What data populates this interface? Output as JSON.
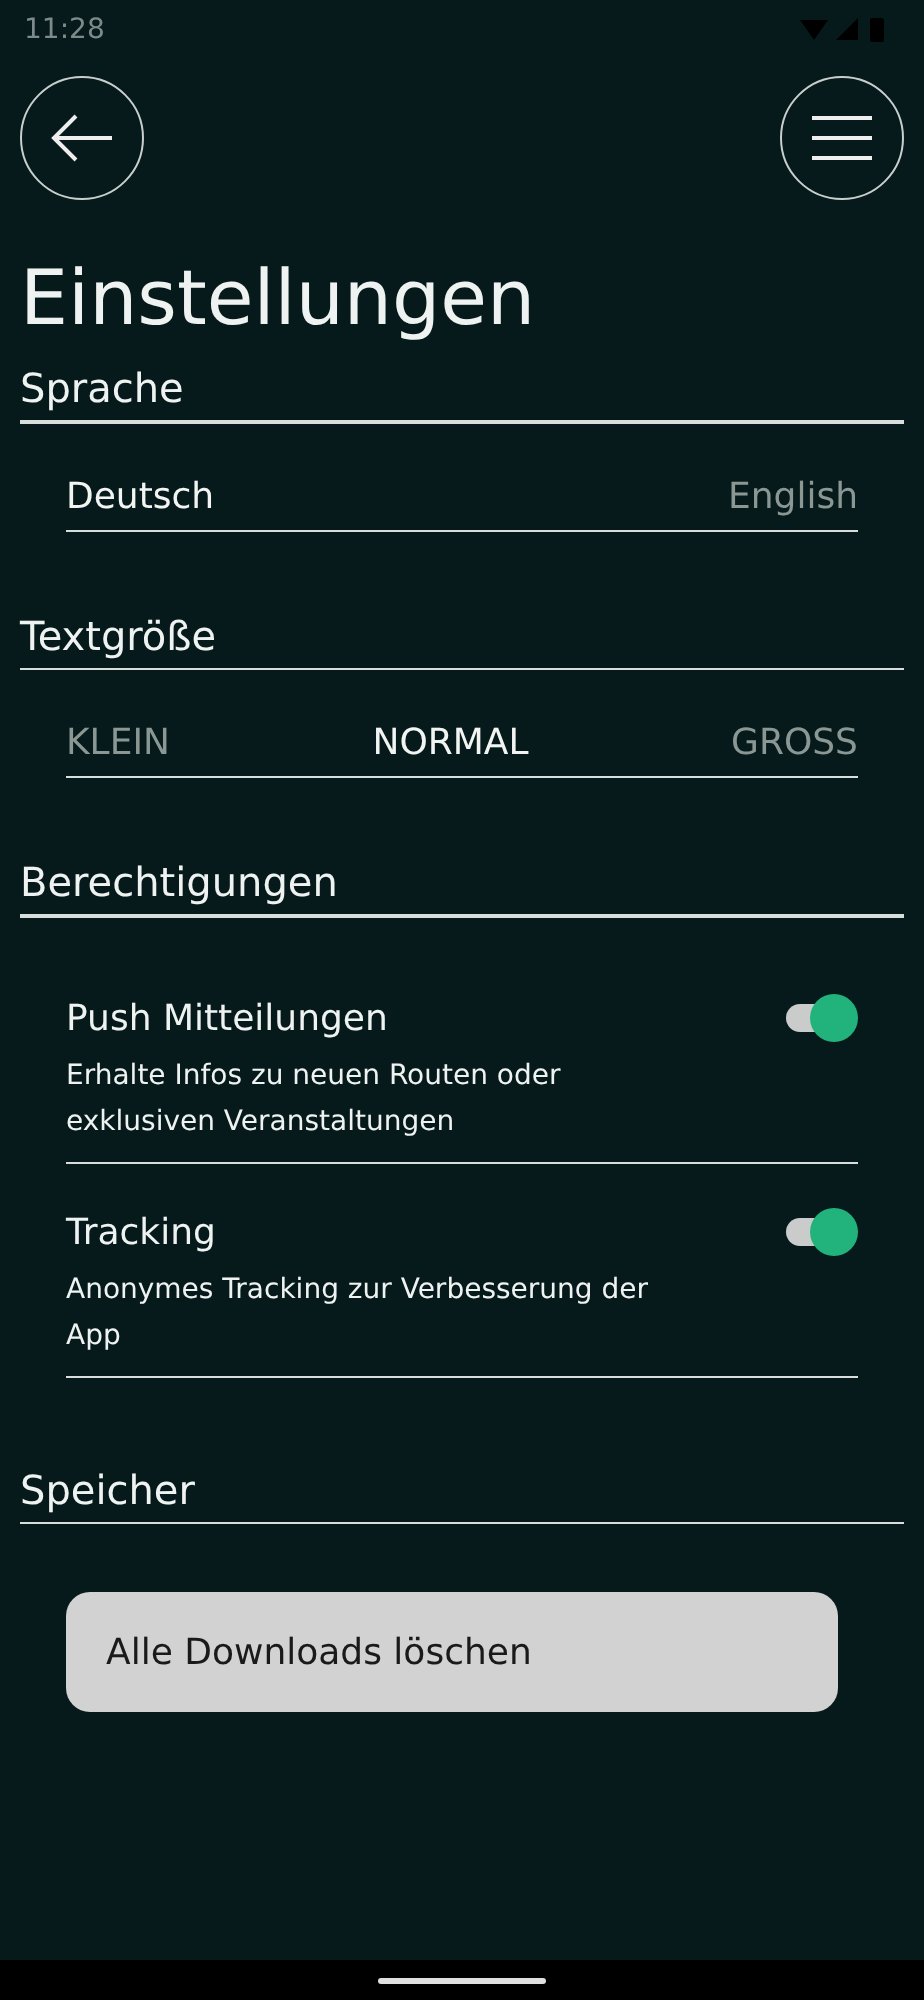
{
  "status_bar": {
    "time": "11:28"
  },
  "title": "Einstellungen",
  "sections": [
    {
      "kind": "segments",
      "heading": "Sprache",
      "options": [
        {
          "label": "Deutsch",
          "selected": true
        },
        {
          "label": "English",
          "selected": false
        }
      ]
    },
    {
      "kind": "segments",
      "heading": "Textgröße",
      "options": [
        {
          "label": "KLEIN",
          "selected": false
        },
        {
          "label": "NORMAL",
          "selected": true
        },
        {
          "label": "GROSS",
          "selected": false
        }
      ]
    },
    {
      "kind": "toggles",
      "heading": "Berechtigungen",
      "items": [
        {
          "label": "Push Mitteilungen",
          "description": "Erhalte Infos zu neuen Routen oder exklusiven Veranstaltungen",
          "on": true
        },
        {
          "label": "Tracking",
          "description": "Anonymes Tracking zur Verbesserung der App",
          "on": true
        }
      ]
    },
    {
      "kind": "action",
      "heading": "Speicher",
      "button": "Alle Downloads löschen"
    }
  ]
}
